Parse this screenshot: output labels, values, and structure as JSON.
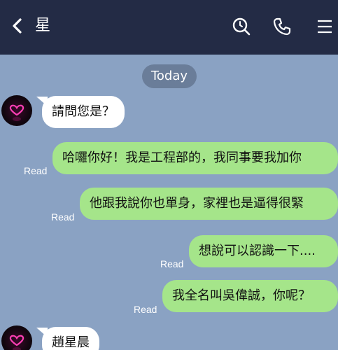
{
  "header": {
    "title": "星",
    "back_icon": "chevron-left-icon",
    "search_icon": "search-icon",
    "call_icon": "phone-icon",
    "menu_icon": "menu-icon",
    "background": "#232b45"
  },
  "chat": {
    "background": "#8aa2c3",
    "date_label": "Today",
    "read_label": "Read",
    "messages": [
      {
        "direction": "in",
        "text": "請問您是？"
      },
      {
        "direction": "out",
        "text": "哈囉你好！我是工程部的，我同事要我加你",
        "status": "Read"
      },
      {
        "direction": "out",
        "text": "他跟我說你也單身，家裡也是逼得很緊",
        "status": "Read"
      },
      {
        "direction": "out",
        "text": "想說可以認識一下....",
        "status": "Read"
      },
      {
        "direction": "out",
        "text": "我全名叫吳偉誠，你呢？",
        "status": "Read"
      },
      {
        "direction": "in",
        "text": "趙星晨"
      }
    ],
    "incoming_color": "#ffffff",
    "outgoing_color": "#a5e58a"
  }
}
